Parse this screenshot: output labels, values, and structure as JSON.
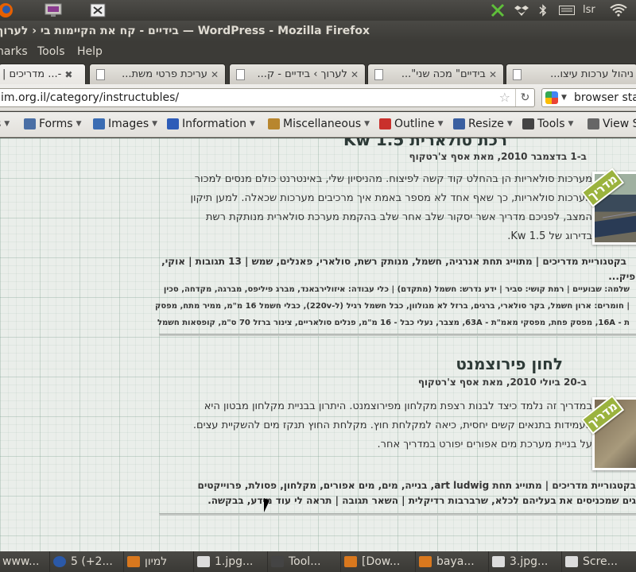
{
  "panel": {
    "lang": "lsr"
  },
  "window": {
    "title": "בידיים - קח את הקיימות בי ‹ לערוך › בידיים — WordPress - Mozilla Firefox"
  },
  "menu": {
    "bookmarks": "harks",
    "tools": "Tools",
    "help": "Help"
  },
  "tabs": [
    {
      "label": "-... מדריכים |",
      "close": "✖"
    },
    {
      "label": "עריכת פרטי משת...",
      "close": "✕"
    },
    {
      "label": "לערוך › בידיים - ק...",
      "close": "✕"
    },
    {
      "label": "בידיים\" מכה שני\"...",
      "close": "✕"
    },
    {
      "label": "ניהול ערכות עיצו...",
      "close": ""
    }
  ],
  "nav": {
    "url": "im.org.il/category/instructubles/",
    "search_placeholder": "browser sta"
  },
  "webdev": {
    "items": [
      "s",
      "Forms",
      "Images",
      "Information",
      "Miscellaneous",
      "Outline",
      "Resize",
      "Tools",
      "View S"
    ],
    "colors": [
      "#6a6a6a",
      "#4a6fa5",
      "#3b6db3",
      "#2e5cb8",
      "#b8862e",
      "#c9302c",
      "#3a5fa0",
      "#444444",
      "#666666"
    ],
    "icons": [
      "css-icon",
      "forms-icon",
      "images-icon",
      "information-icon",
      "miscellaneous-icon",
      "outline-icon",
      "resize-icon",
      "tools-icon",
      "view-source-icon"
    ]
  },
  "posts": [
    {
      "title": "רכת סולארית 1.5 Kw",
      "date": "ב-1 בדצמבר 2010, מאת אסף צ'רטקוף",
      "body": [
        "מערכות סולאריות הן בהחלט קוד קשה לפיצוח. מהניסיון שלי, באינטרנט כולם מנסים למכור",
        "מערכות סולאריות, כך שאף אחד לא מספר באמת איך מרכיבים מערכות שכאלה. למען תיקון",
        "המצב, לפניכם מדריך אשר יסקור שלב אחר שלב בהקמת מערכת סולארית מנותקת רשת",
        "בדירוג של 1.5 Kw."
      ],
      "meta": [
        "בקטגוריית מדריכים | מתוייג תחת אנרגיה, חשמל, מנותק רשת, סולארי, פאנלים, שמש | 13 תגובות | אוקי,",
        "מספיק..."
      ],
      "meta2": [
        "שלמה: שבועיים | רמת קושי: סביר | ידע נדרש: חשמל (מתקדם) | כלי עבודה: איזולירבאנד, מברג פיליפס, מברגה, מקדחה, סכין",
        "| חומרים: ארון חשמל, בקר סולארי, ברגים, ברזל לא מגולוון, כבל חשמל רגיל (ל-220v), כבלי חשמל 16 מ\"מ, ממיר מתח, מפסק",
        "ת - 16A, מפסק פחת, מפסקי מאמ\"ת - 63A, מצבר, נעלי כבל - 16 מ\"מ, פנלים סולאריים, צינור ברזל 70 ס\"מ, קופסאות חשמל"
      ],
      "badge": "מדריך"
    },
    {
      "title": "לחון פירוצמנט",
      "date": "ב-20 ביולי 2010, מאת אסף צ'רטקוף",
      "body": [
        "במדריך זה נלמד כיצד לבנות רצפת מקלחון מפירוצמנט. היתרון בבניית מקלחון מבטון היא",
        "העמידות בתנאים קשים יחסית, כיאה למקלחת חוץ. מקלחת החוץ תנקז מים להשקיית עצים.",
        "על בניית מערכת מים אפורים יפורט במדריך אחר."
      ],
      "meta": [
        "בקטגוריית מדריכים | מתוייג תחת art ludwig, בנייה, מים, מים אפורים, מקלחון, פסולת, פרוייקטים",
        "גים שמכניסים את בעליהם לכלא, שרברבות רדיקלית | השאר תגובה | תראה לי עוד מידע, בבקשה."
      ],
      "badge": "מדריך"
    }
  ],
  "taskbar": [
    "www...",
    "5 (+2...",
    "למיון",
    "1.jpg...",
    "Tool...",
    "[Dow...",
    "baya...",
    "3.jpg...",
    "Scre..."
  ]
}
